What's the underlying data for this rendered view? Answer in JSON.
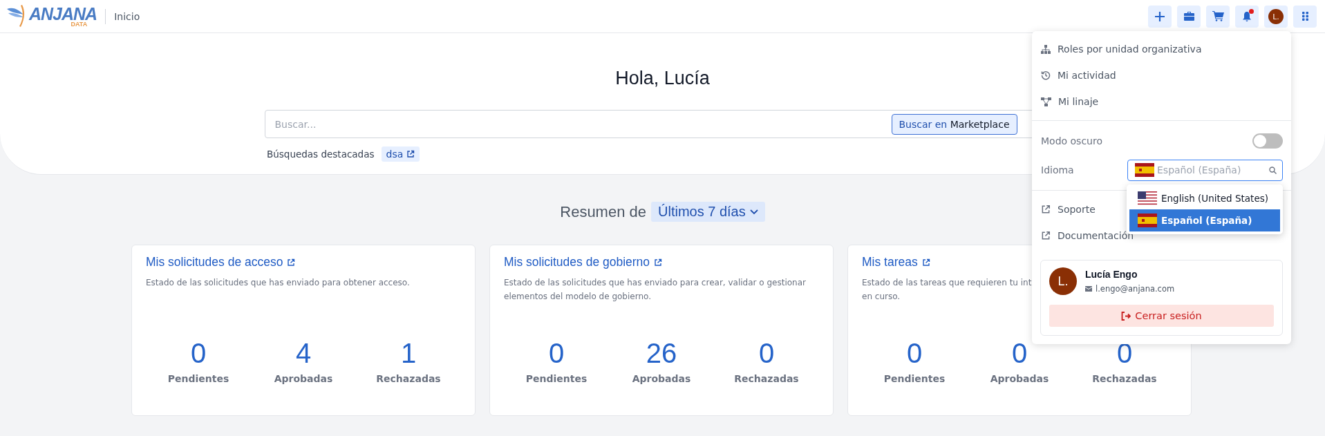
{
  "header": {
    "logo": {
      "main": "ANJANA",
      "sub": "DATA"
    },
    "breadcrumb": "Inicio",
    "avatar": "L.",
    "notification": true
  },
  "hero": {
    "greeting": "Hola, Lucía",
    "search": {
      "placeholder": "Buscar...",
      "button_prefix": "Buscar en",
      "button_strong": "Marketplace"
    },
    "featured_label": "Búsquedas destacadas",
    "featured": [
      "dsa"
    ]
  },
  "summary": {
    "label": "Resumen de",
    "period": "Últimos 7 días"
  },
  "cards": [
    {
      "title": "Mis solicitudes de acceso",
      "description": [
        "Estado de las solicitudes que has enviado para obtener acceso."
      ],
      "stats": [
        {
          "value": "0",
          "label": "Pendientes"
        },
        {
          "value": "4",
          "label": "Aprobadas"
        },
        {
          "value": "1",
          "label": "Rechazadas"
        }
      ]
    },
    {
      "title": "Mis solicitudes de gobierno",
      "description": [
        "Estado de las solicitudes que has enviado para crear, validar o gestionar",
        "elementos del modelo de gobierno."
      ],
      "stats": [
        {
          "value": "0",
          "label": "Pendientes"
        },
        {
          "value": "26",
          "label": "Aprobadas"
        },
        {
          "value": "0",
          "label": "Rechazadas"
        }
      ]
    },
    {
      "title": "Mis tareas",
      "description": [
        "Estado de las tareas que requieren tu int",
        "en curso."
      ],
      "stats": [
        {
          "value": "0",
          "label": "Pendientes"
        },
        {
          "value": "0",
          "label": "Aprobadas"
        },
        {
          "value": "0",
          "label": "Rechazadas"
        }
      ]
    }
  ],
  "user_menu": {
    "links": [
      {
        "kind": "org",
        "label": "Roles por unidad organizativa"
      },
      {
        "kind": "history",
        "label": "Mi actividad"
      },
      {
        "kind": "lineage",
        "label": "Mi linaje"
      }
    ],
    "dark_mode": {
      "label": "Modo oscuro",
      "on": false
    },
    "language": {
      "label": "Idioma",
      "placeholder": "Español (España)",
      "options": [
        {
          "kind": "us",
          "label": "English (United States)",
          "selected": false
        },
        {
          "kind": "es",
          "label": "Español (España)",
          "selected": true
        }
      ]
    },
    "external": [
      {
        "label": "Soporte"
      },
      {
        "label": "Documentación"
      }
    ],
    "user": {
      "avatar": "L.",
      "name": "Lucía Engo",
      "email": "l.engo@anjana.com"
    },
    "logout": "Cerrar sesión"
  }
}
